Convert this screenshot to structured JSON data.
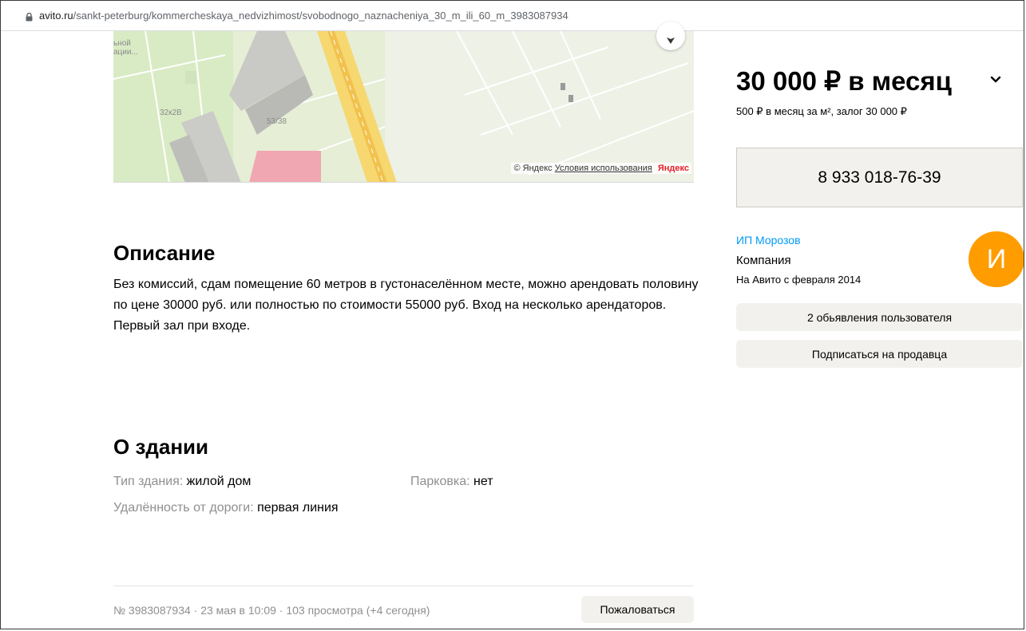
{
  "browser": {
    "url_host": "avito.ru",
    "url_path": "/sankt-peterburg/kommercheskaya_nedvizhimost/svobodnogo_naznacheniya_30_m_ili_60_m_3983087934",
    "lock_icon": "lock-icon"
  },
  "map": {
    "labels": [
      "ьной",
      "ации...",
      "32к2В",
      "53/38"
    ],
    "attribution_copyright": "© Яндекс",
    "attribution_terms": "Условия использования",
    "attribution_logo": "Яндекс"
  },
  "description": {
    "heading": "Описание",
    "text": "Без комиссий, сдам помещение 60 метров в густонаселённом месте, можно арендовать половину по цене 30000 руб. или полностью по стоимости 55000 руб. Вход на несколько арендаторов. Первый зал при входе."
  },
  "building": {
    "heading": "О здании",
    "params": [
      {
        "key": "Тип здания: ",
        "value": "жилой дом"
      },
      {
        "key": "Парковка: ",
        "value": "нет"
      },
      {
        "key": "Удалённость от дороги: ",
        "value": "первая линия"
      }
    ]
  },
  "footer": {
    "meta": "№ 3983087934 · 23 мая в 10:09 · 103 просмотра (+4 сегодня)",
    "report_label": "Пожаловаться"
  },
  "sidebar": {
    "price": "30 000 ₽ в месяц",
    "price_details": "500 ₽ в месяц за м², залог 30 000 ₽",
    "phone": "8 933 018-76-39",
    "seller": {
      "name": "ИП Морозов",
      "type": "Компания",
      "since": "На Авито с февраля 2014",
      "avatar_letter": "И"
    },
    "ads_button": "2 обьявления пользователя",
    "subscribe_button": "Подписаться на продавца"
  },
  "colors": {
    "link": "#0099f7",
    "avatar_bg": "#ff9c00",
    "button_bg": "#f2f1ee",
    "map_road": "#f7d770"
  }
}
